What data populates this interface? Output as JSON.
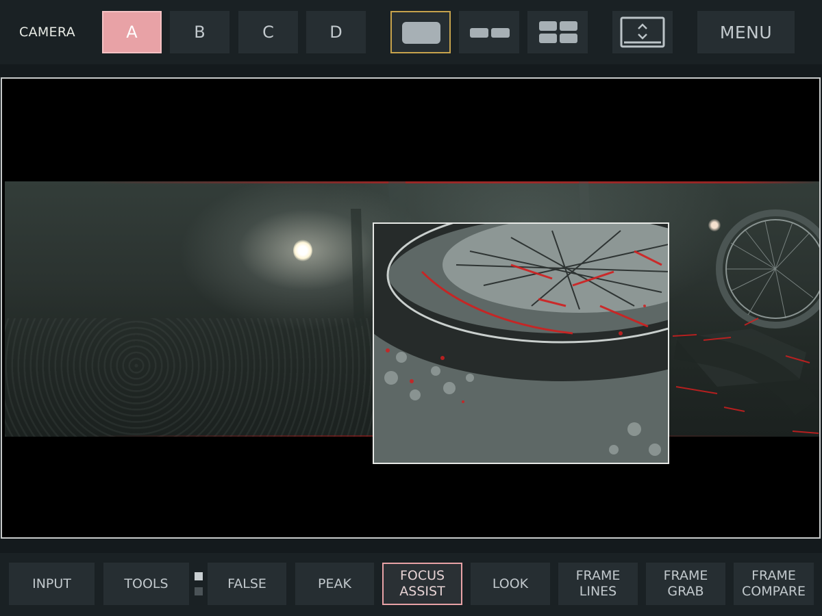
{
  "topbar": {
    "camera_label": "CAMERA",
    "cameras": [
      {
        "label": "A",
        "active": true
      },
      {
        "label": "B",
        "active": false
      },
      {
        "label": "C",
        "active": false
      },
      {
        "label": "D",
        "active": false
      }
    ],
    "layouts": [
      {
        "icon": "single-view-icon",
        "active": true
      },
      {
        "icon": "dual-view-icon",
        "active": false
      },
      {
        "icon": "quad-view-icon",
        "active": false
      }
    ],
    "fullscreen_icon": "expand-vertical-icon",
    "menu_label": "MENU"
  },
  "toolbar": {
    "tools": [
      {
        "line1": "INPUT",
        "line2": ""
      },
      {
        "line1": "TOOLS",
        "line2": ""
      },
      {
        "line1": "FALSE",
        "line2": ""
      },
      {
        "line1": "PEAK",
        "line2": ""
      },
      {
        "line1": "FOCUS",
        "line2": "ASSIST"
      },
      {
        "line1": "LOOK",
        "line2": ""
      },
      {
        "line1": "FRAME",
        "line2": "LINES"
      },
      {
        "line1": "FRAME",
        "line2": "GRAB"
      },
      {
        "line1": "FRAME",
        "line2": "COMPARE"
      }
    ],
    "active_tool": "FOCUS ASSIST",
    "page_indicator": {
      "pages": 2,
      "current": 1
    }
  },
  "colors": {
    "accent_active": "#e8a2a6",
    "layout_active_border": "#c7a34c",
    "button_bg": "#262e32",
    "bar_bg": "#1a2124",
    "focus_peak": "#d11f1f"
  }
}
